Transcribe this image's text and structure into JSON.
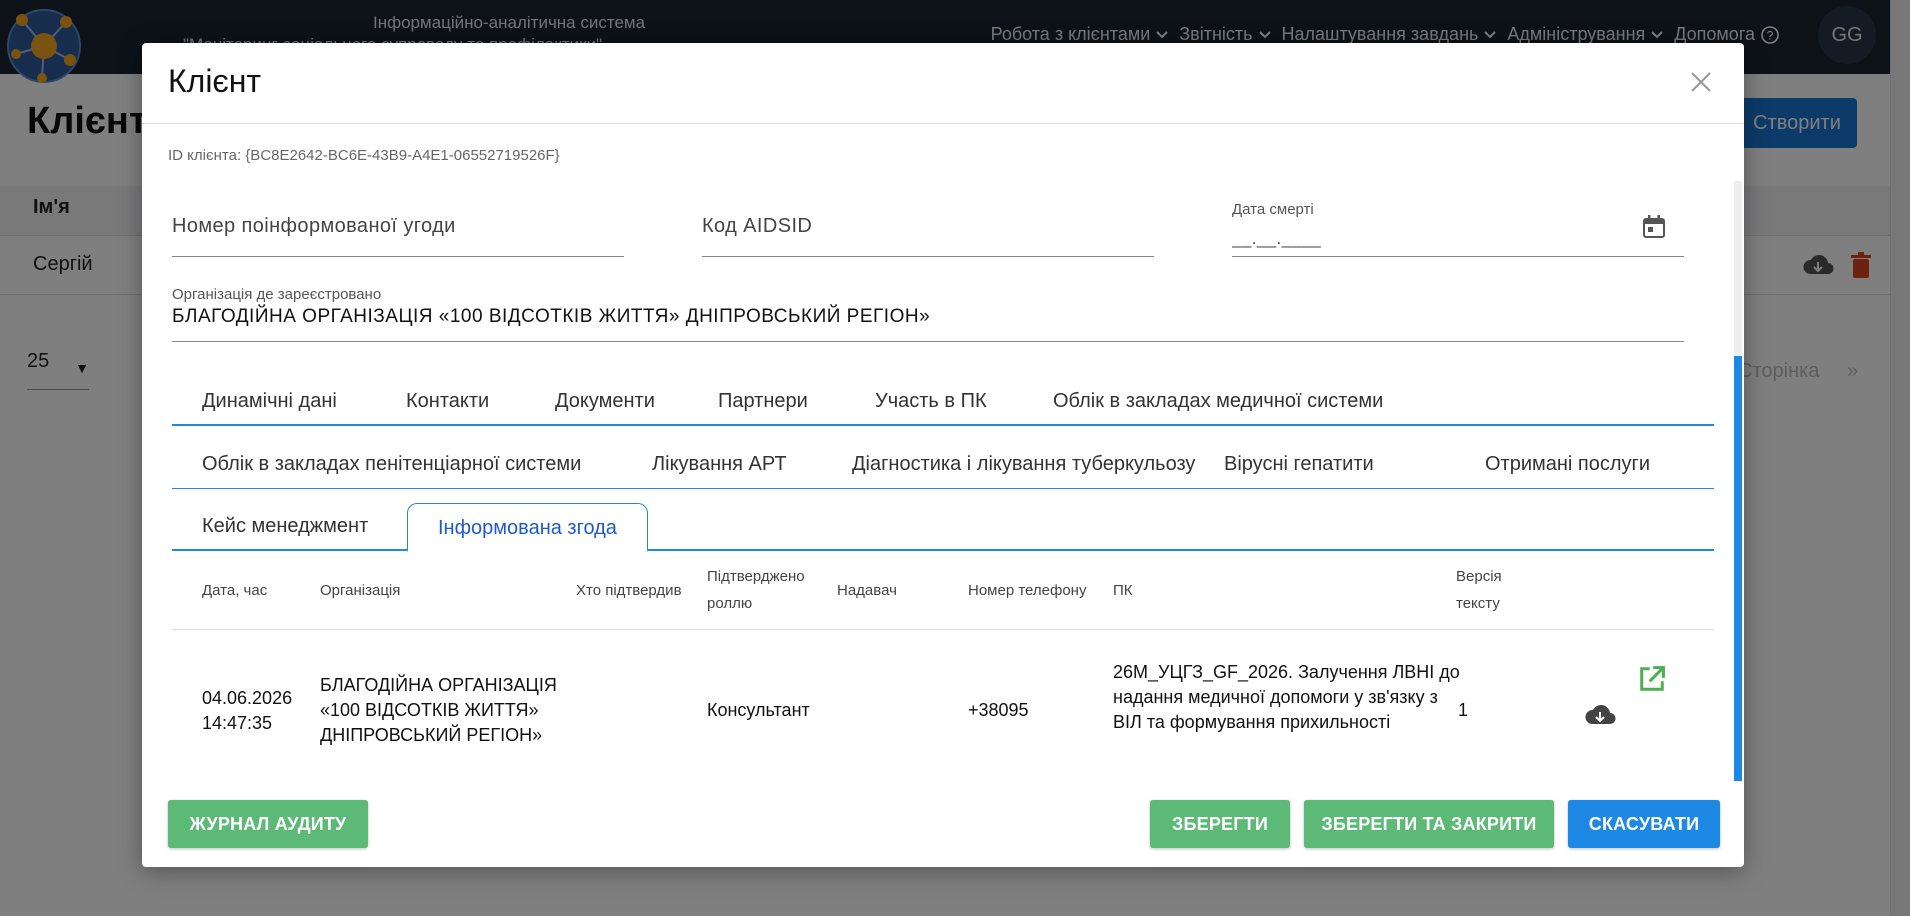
{
  "app": {
    "system_title_line1": "Інформаційно-аналітична система",
    "system_title_line2": "\"Моніторинг соціального супроводу та профілактики\"",
    "nav": [
      {
        "label": "Робота з клієнтами"
      },
      {
        "label": "Звітність"
      },
      {
        "label": "Налаштування завдань"
      },
      {
        "label": "Адміністрування"
      },
      {
        "label": "Допомога"
      }
    ],
    "avatar_initials": "GG",
    "page_title": "Клієнти",
    "create_label": "Створити",
    "table_header_name": "Ім'я",
    "table_row_name": "Сергій",
    "page_size": "25",
    "pager_label": "Сторінка",
    "pager_next": "»"
  },
  "modal": {
    "title": "Клієнт",
    "client_id": "ID клієнта: {BC8E2642-BC6E-43B9-A4E1-06552719526F}",
    "fields": {
      "consent_number_placeholder": "Номер поінформованої угоди",
      "aidsid_placeholder": "Код AIDSID",
      "death_date_label": "Дата смерті",
      "death_date_mask": "__.__.____",
      "org_label": "Організація де зареєстровано",
      "org_value": "БЛАГОДІЙНА ОРГАНІЗАЦІЯ «100 ВІДСОТКІВ ЖИТТЯ» ДНІПРОВСЬКИЙ РЕГІОН»"
    },
    "tabs_row1": [
      "Динамічні дані",
      "Контакти",
      "Документи",
      "Партнери",
      "Участь в ПК",
      "Облік в закладах медичної системи"
    ],
    "tabs_row2": [
      "Облік в закладах пенітенціарної системи",
      "Лікування АРТ",
      "Діагностика і лікування туберкульозу",
      "Вірусні гепатити",
      "Отримані послуги"
    ],
    "tabs_row3": [
      "Кейс менеджмент",
      "Інформована згода"
    ],
    "active_tab": "Інформована згода",
    "consent_table": {
      "columns": [
        "Дата, час",
        "Організація",
        "Хто підтвердив",
        "Підтверджено роллю",
        "Надавач",
        "Номер телефону",
        "ПК",
        "Версія тексту"
      ],
      "rows": [
        {
          "datetime": "04.06.2026 14:47:35",
          "organization": "БЛАГОДІЙНА ОРГАНІЗАЦІЯ «100 ВІДСОТКІВ ЖИТТЯ» ДНІПРОВСЬКИЙ РЕГІОН»",
          "confirmed_by": "",
          "role": "Консультант",
          "provider": "",
          "phone": "+38095",
          "program": "26М_УЦГЗ_GF_2026. Залучення ЛВНІ до надання медичної допомоги у зв'язку з ВІЛ та формування прихильності",
          "text_version": "1"
        }
      ]
    },
    "buttons": {
      "audit": "ЖУРНАЛ АУДИТУ",
      "save": "ЗБЕРЕГТИ",
      "save_close": "ЗБЕРЕГТИ ТА ЗАКРИТИ",
      "cancel": "СКАСУВАТИ"
    }
  },
  "colors": {
    "topbar": "#1b2433",
    "accent_blue": "#1e88e5",
    "action_green": "#5cb976",
    "delete_red": "#d9441c"
  }
}
